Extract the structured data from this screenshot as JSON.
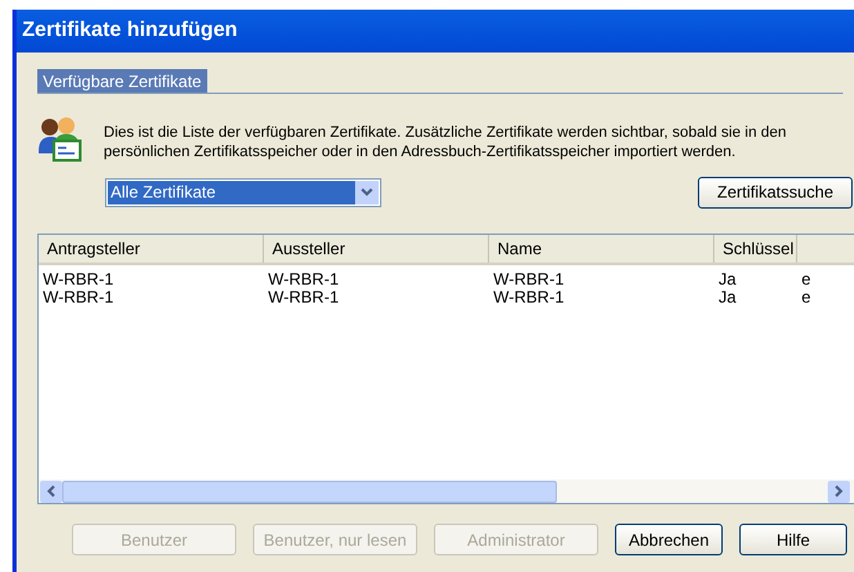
{
  "window": {
    "title": "Zertifikate hinzufügen"
  },
  "tab": {
    "label": "Verfügbare Zertifikate",
    "selected": true
  },
  "description": "Dies ist die Liste der verfügbaren Zertifikate. Zusätzliche Zertifikate werden sichtbar, sobald sie in den persönlichen Zertifikatsspeicher oder in den Adressbuch-Zertifikatsspeicher importiert werden.",
  "filter": {
    "value": "Alle Zertifikate"
  },
  "search_button": {
    "label": "Zertifikatssuche",
    "disabled": false
  },
  "table": {
    "columns": [
      "Antragsteller",
      "Aussteller",
      "Name",
      "Schlüssel"
    ],
    "rows": [
      [
        "W-RBR-1",
        "W-RBR-1",
        "W-RBR-1",
        "Ja",
        "e"
      ],
      [
        "W-RBR-1",
        "W-RBR-1",
        "W-RBR-1",
        "Ja",
        "e"
      ]
    ]
  },
  "buttons": [
    {
      "label": "Benutzer",
      "disabled": true
    },
    {
      "label": "Benutzer, nur lesen",
      "disabled": true
    },
    {
      "label": "Administrator",
      "disabled": true
    },
    {
      "label": "Abbrechen",
      "disabled": false
    },
    {
      "label": "Hilfe",
      "disabled": false
    }
  ]
}
